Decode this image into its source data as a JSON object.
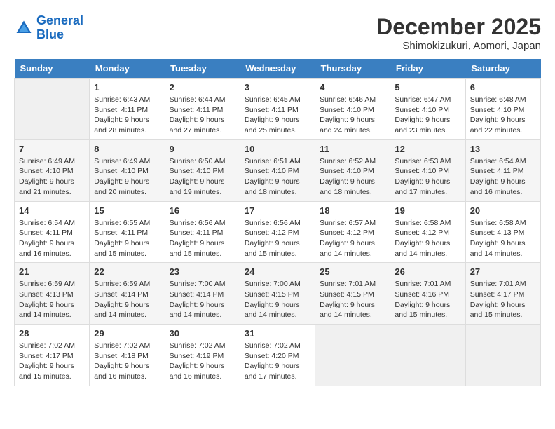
{
  "logo": {
    "line1": "General",
    "line2": "Blue"
  },
  "title": "December 2025",
  "subtitle": "Shimokizukuri, Aomori, Japan",
  "weekdays": [
    "Sunday",
    "Monday",
    "Tuesday",
    "Wednesday",
    "Thursday",
    "Friday",
    "Saturday"
  ],
  "weeks": [
    [
      {
        "num": "",
        "empty": true
      },
      {
        "num": "1",
        "sunrise": "Sunrise: 6:43 AM",
        "sunset": "Sunset: 4:11 PM",
        "daylight": "Daylight: 9 hours and 28 minutes."
      },
      {
        "num": "2",
        "sunrise": "Sunrise: 6:44 AM",
        "sunset": "Sunset: 4:11 PM",
        "daylight": "Daylight: 9 hours and 27 minutes."
      },
      {
        "num": "3",
        "sunrise": "Sunrise: 6:45 AM",
        "sunset": "Sunset: 4:11 PM",
        "daylight": "Daylight: 9 hours and 25 minutes."
      },
      {
        "num": "4",
        "sunrise": "Sunrise: 6:46 AM",
        "sunset": "Sunset: 4:10 PM",
        "daylight": "Daylight: 9 hours and 24 minutes."
      },
      {
        "num": "5",
        "sunrise": "Sunrise: 6:47 AM",
        "sunset": "Sunset: 4:10 PM",
        "daylight": "Daylight: 9 hours and 23 minutes."
      },
      {
        "num": "6",
        "sunrise": "Sunrise: 6:48 AM",
        "sunset": "Sunset: 4:10 PM",
        "daylight": "Daylight: 9 hours and 22 minutes."
      }
    ],
    [
      {
        "num": "7",
        "sunrise": "Sunrise: 6:49 AM",
        "sunset": "Sunset: 4:10 PM",
        "daylight": "Daylight: 9 hours and 21 minutes."
      },
      {
        "num": "8",
        "sunrise": "Sunrise: 6:49 AM",
        "sunset": "Sunset: 4:10 PM",
        "daylight": "Daylight: 9 hours and 20 minutes."
      },
      {
        "num": "9",
        "sunrise": "Sunrise: 6:50 AM",
        "sunset": "Sunset: 4:10 PM",
        "daylight": "Daylight: 9 hours and 19 minutes."
      },
      {
        "num": "10",
        "sunrise": "Sunrise: 6:51 AM",
        "sunset": "Sunset: 4:10 PM",
        "daylight": "Daylight: 9 hours and 18 minutes."
      },
      {
        "num": "11",
        "sunrise": "Sunrise: 6:52 AM",
        "sunset": "Sunset: 4:10 PM",
        "daylight": "Daylight: 9 hours and 18 minutes."
      },
      {
        "num": "12",
        "sunrise": "Sunrise: 6:53 AM",
        "sunset": "Sunset: 4:10 PM",
        "daylight": "Daylight: 9 hours and 17 minutes."
      },
      {
        "num": "13",
        "sunrise": "Sunrise: 6:54 AM",
        "sunset": "Sunset: 4:11 PM",
        "daylight": "Daylight: 9 hours and 16 minutes."
      }
    ],
    [
      {
        "num": "14",
        "sunrise": "Sunrise: 6:54 AM",
        "sunset": "Sunset: 4:11 PM",
        "daylight": "Daylight: 9 hours and 16 minutes."
      },
      {
        "num": "15",
        "sunrise": "Sunrise: 6:55 AM",
        "sunset": "Sunset: 4:11 PM",
        "daylight": "Daylight: 9 hours and 15 minutes."
      },
      {
        "num": "16",
        "sunrise": "Sunrise: 6:56 AM",
        "sunset": "Sunset: 4:11 PM",
        "daylight": "Daylight: 9 hours and 15 minutes."
      },
      {
        "num": "17",
        "sunrise": "Sunrise: 6:56 AM",
        "sunset": "Sunset: 4:12 PM",
        "daylight": "Daylight: 9 hours and 15 minutes."
      },
      {
        "num": "18",
        "sunrise": "Sunrise: 6:57 AM",
        "sunset": "Sunset: 4:12 PM",
        "daylight": "Daylight: 9 hours and 14 minutes."
      },
      {
        "num": "19",
        "sunrise": "Sunrise: 6:58 AM",
        "sunset": "Sunset: 4:12 PM",
        "daylight": "Daylight: 9 hours and 14 minutes."
      },
      {
        "num": "20",
        "sunrise": "Sunrise: 6:58 AM",
        "sunset": "Sunset: 4:13 PM",
        "daylight": "Daylight: 9 hours and 14 minutes."
      }
    ],
    [
      {
        "num": "21",
        "sunrise": "Sunrise: 6:59 AM",
        "sunset": "Sunset: 4:13 PM",
        "daylight": "Daylight: 9 hours and 14 minutes."
      },
      {
        "num": "22",
        "sunrise": "Sunrise: 6:59 AM",
        "sunset": "Sunset: 4:14 PM",
        "daylight": "Daylight: 9 hours and 14 minutes."
      },
      {
        "num": "23",
        "sunrise": "Sunrise: 7:00 AM",
        "sunset": "Sunset: 4:14 PM",
        "daylight": "Daylight: 9 hours and 14 minutes."
      },
      {
        "num": "24",
        "sunrise": "Sunrise: 7:00 AM",
        "sunset": "Sunset: 4:15 PM",
        "daylight": "Daylight: 9 hours and 14 minutes."
      },
      {
        "num": "25",
        "sunrise": "Sunrise: 7:01 AM",
        "sunset": "Sunset: 4:15 PM",
        "daylight": "Daylight: 9 hours and 14 minutes."
      },
      {
        "num": "26",
        "sunrise": "Sunrise: 7:01 AM",
        "sunset": "Sunset: 4:16 PM",
        "daylight": "Daylight: 9 hours and 15 minutes."
      },
      {
        "num": "27",
        "sunrise": "Sunrise: 7:01 AM",
        "sunset": "Sunset: 4:17 PM",
        "daylight": "Daylight: 9 hours and 15 minutes."
      }
    ],
    [
      {
        "num": "28",
        "sunrise": "Sunrise: 7:02 AM",
        "sunset": "Sunset: 4:17 PM",
        "daylight": "Daylight: 9 hours and 15 minutes."
      },
      {
        "num": "29",
        "sunrise": "Sunrise: 7:02 AM",
        "sunset": "Sunset: 4:18 PM",
        "daylight": "Daylight: 9 hours and 16 minutes."
      },
      {
        "num": "30",
        "sunrise": "Sunrise: 7:02 AM",
        "sunset": "Sunset: 4:19 PM",
        "daylight": "Daylight: 9 hours and 16 minutes."
      },
      {
        "num": "31",
        "sunrise": "Sunrise: 7:02 AM",
        "sunset": "Sunset: 4:20 PM",
        "daylight": "Daylight: 9 hours and 17 minutes."
      },
      {
        "num": "",
        "empty": true
      },
      {
        "num": "",
        "empty": true
      },
      {
        "num": "",
        "empty": true
      }
    ]
  ]
}
